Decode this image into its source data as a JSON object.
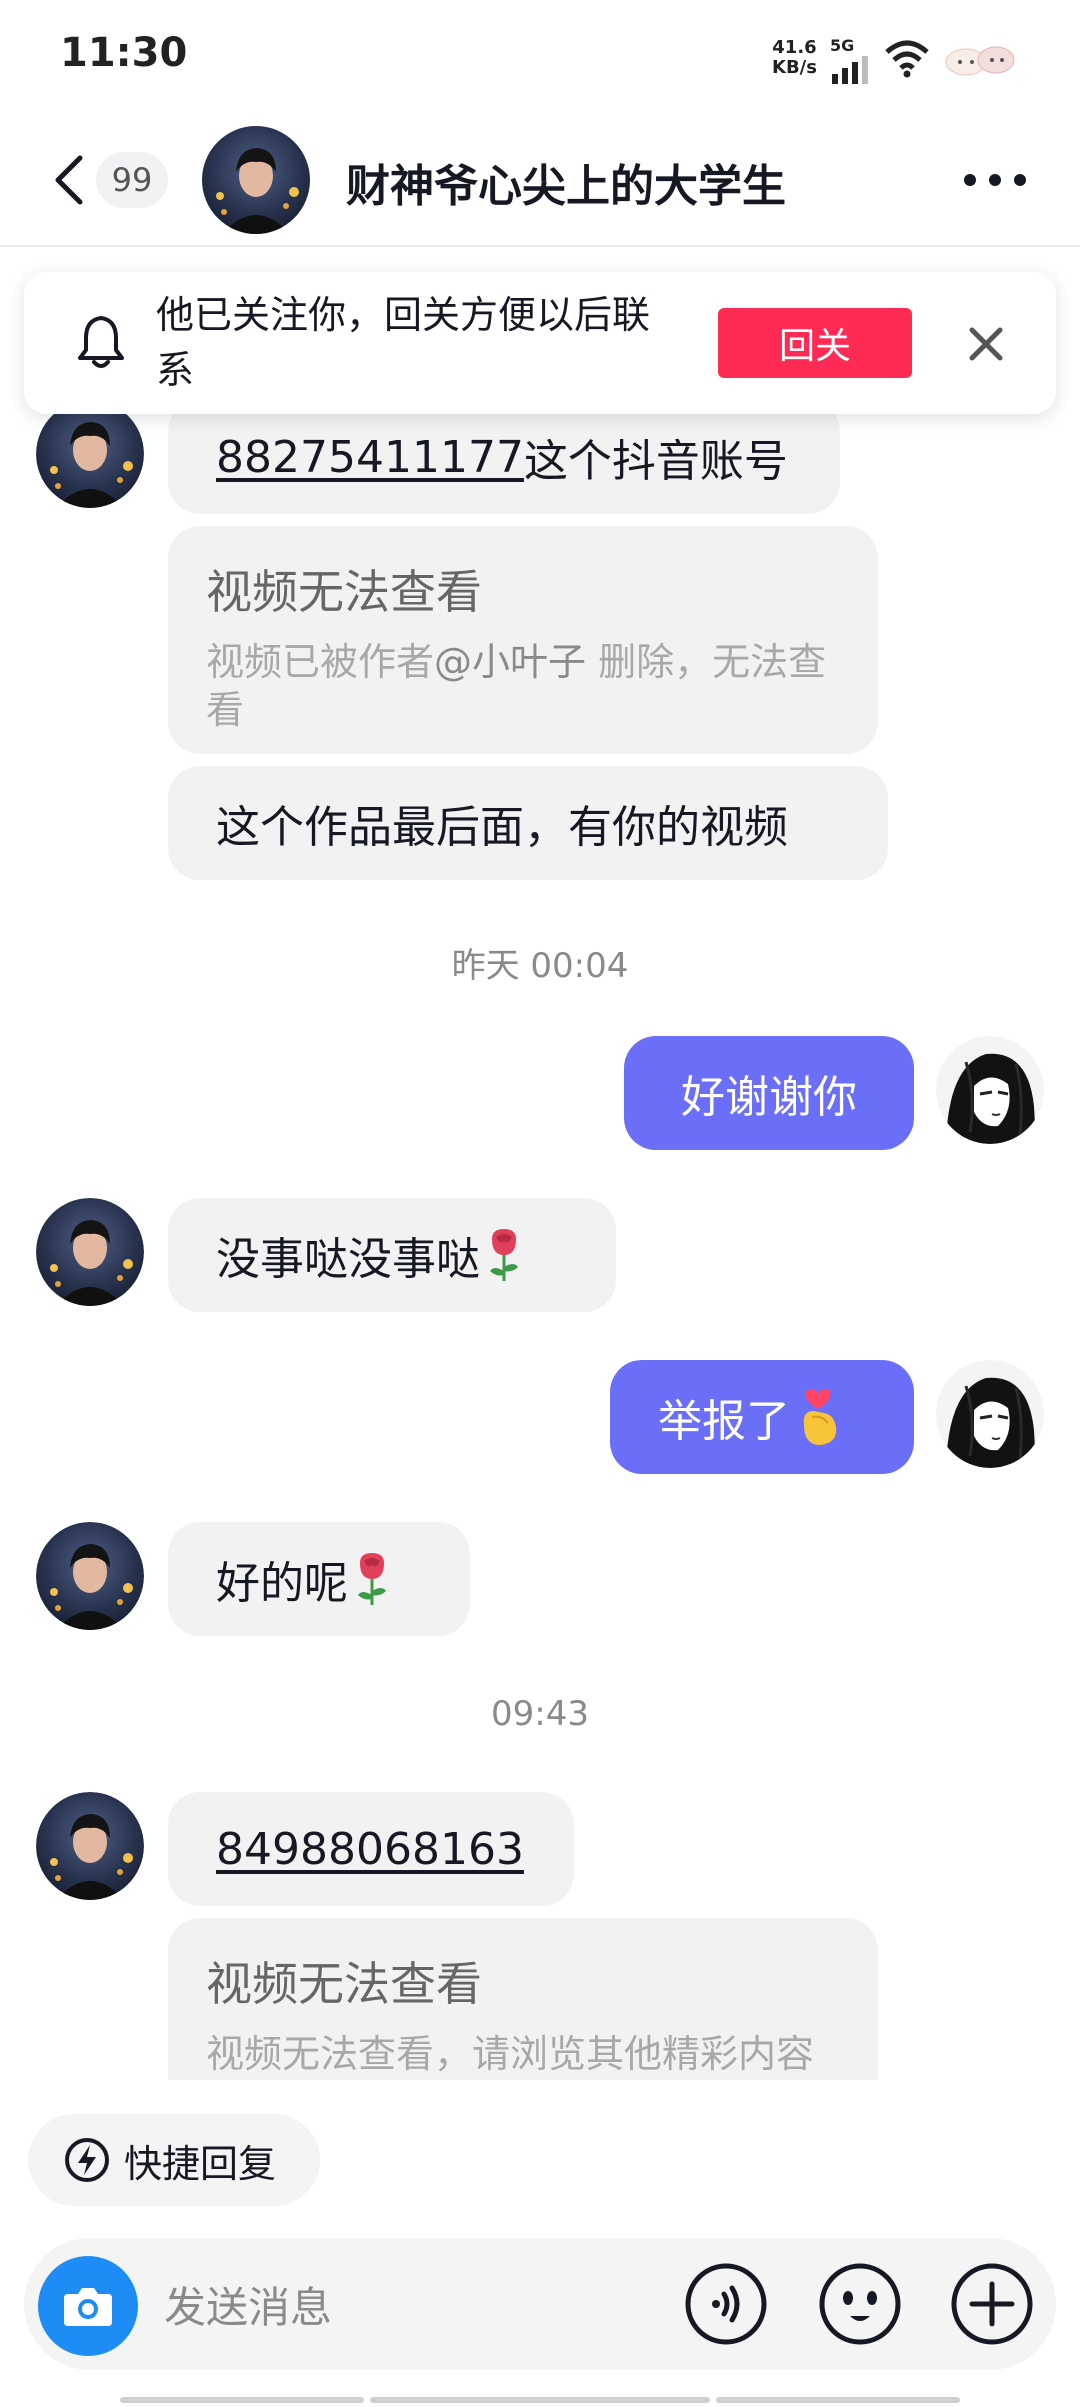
{
  "status_bar": {
    "time": "11:30",
    "speed_value": "41.6",
    "speed_unit": "KB/s",
    "network": "5G"
  },
  "header": {
    "unread_count": "99",
    "title": "财神爷心尖上的大学生"
  },
  "follow_banner": {
    "text": "他已关注你，回关方便以后联系",
    "button": "回关"
  },
  "messages": {
    "m1_number": "88275411177",
    "m1_rest": "这个抖音账号",
    "card1_title": "视频无法查看",
    "card1_sub_pre": "视频已被作者",
    "card1_sub_mention": "@小叶子",
    "card1_sub_post": " 删除，无法查看",
    "m2": "这个作品最后面，有你的视频",
    "time1": "昨天 00:04",
    "m3": "好谢谢你",
    "m4": "没事哒没事哒",
    "m5": "举报了",
    "m6": "好的呢",
    "time2": "09:43",
    "m7": "84988068163",
    "card2_title": "视频无法查看",
    "card2_sub": "视频无法查看，请浏览其他精彩内容吧"
  },
  "bottom": {
    "quick_reply": "快捷回复",
    "input_placeholder": "发送消息"
  },
  "icons": {
    "back": "chevron-left-icon",
    "more": "more-dots-icon",
    "bell": "bell-icon",
    "close": "close-icon",
    "camera": "camera-icon",
    "voice": "voice-icon",
    "emoji": "emoji-icon",
    "plus": "plus-icon",
    "quick_reply": "lightning-icon",
    "rose": "rose-emoji",
    "heart_hand": "finger-heart-emoji"
  },
  "colors": {
    "accent": "#fe2c55",
    "outgoing_bubble": "#6b6ff7",
    "incoming_bubble": "#f2f2f2",
    "camera": "#1e8cf5"
  }
}
